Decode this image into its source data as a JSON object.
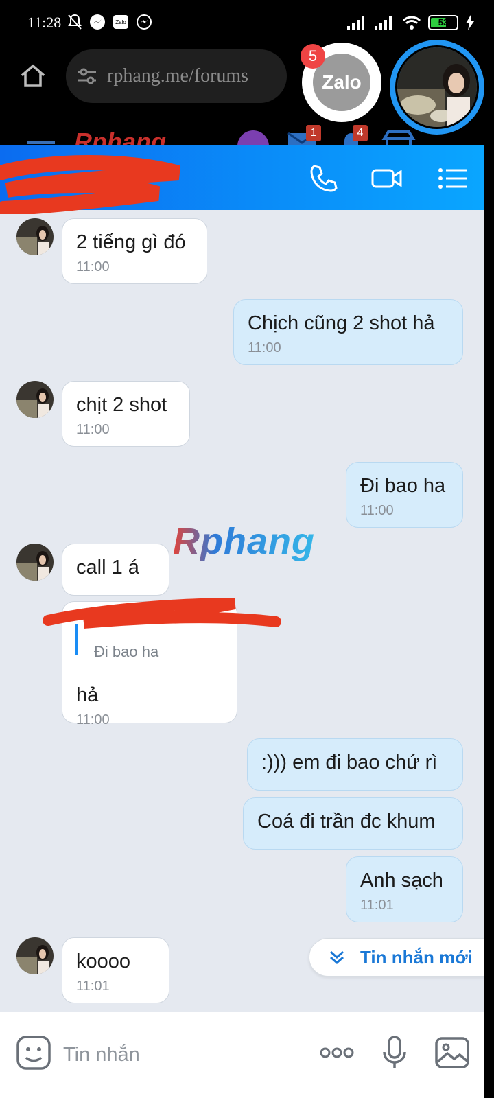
{
  "status_bar": {
    "time": "11:28",
    "battery": "53",
    "notification_icons": [
      "bell-off-icon",
      "messenger-icon",
      "zalo-icon",
      "messenger-icon"
    ]
  },
  "browser": {
    "url": "rphang.me/forums",
    "badges": [
      "1",
      "4"
    ]
  },
  "zalo_bubble": {
    "label": "Zalo",
    "unread_count": "5"
  },
  "watermark": "Rphang",
  "messages": [
    {
      "direction": "in",
      "text": "2 tiếng gì đó",
      "time": "11:00"
    },
    {
      "direction": "out",
      "text": "Chịch cũng 2 shot hả",
      "time": "11:00"
    },
    {
      "direction": "in",
      "text": "chịt 2 shot",
      "time": "11:00"
    },
    {
      "direction": "out",
      "text": "Đi bao ha",
      "time": "11:00"
    },
    {
      "direction": "in",
      "text": "call 1 á",
      "time": ""
    },
    {
      "direction": "in",
      "quote": "Đi bao ha",
      "text": "hả",
      "time": "11:00"
    },
    {
      "direction": "out",
      "text": ":))) em đi bao chứ rì",
      "time": ""
    },
    {
      "direction": "out",
      "text": "Coá đi trần đc khum",
      "time": ""
    },
    {
      "direction": "out",
      "text": "Anh sạch",
      "time": "11:01"
    },
    {
      "direction": "in",
      "text": "koooo",
      "time": "11:01"
    }
  ],
  "new_messages_button": "Tin nhắn mới",
  "composer": {
    "placeholder": "Tin nhắn"
  },
  "colors": {
    "header_start": "#0b6cf0",
    "header_end": "#0aa6ff",
    "outgoing_bubble": "#d6ecfb",
    "chat_background": "#e5e9f0"
  }
}
